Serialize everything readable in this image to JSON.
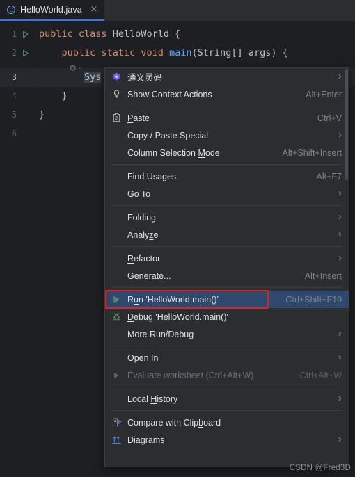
{
  "window": {
    "background": "#1E1F22"
  },
  "tab": {
    "label": "HelloWorld.java",
    "icon": "java-class-icon",
    "close_icon": "close-icon",
    "close_glyph": "×"
  },
  "editor": {
    "lines": [
      {
        "number": "1",
        "has_run_gutter": true,
        "text": "public class HelloWorld {"
      },
      {
        "number": "2",
        "has_run_gutter": true,
        "text": "    public static void main(String[] args) {"
      },
      {
        "number": "3",
        "has_run_gutter": false,
        "text": "        Sys",
        "current": true
      },
      {
        "number": "4",
        "has_run_gutter": false,
        "text": "    }"
      },
      {
        "number": "5",
        "has_run_gutter": false,
        "text": "}"
      },
      {
        "number": "6",
        "has_run_gutter": false,
        "text": ""
      }
    ],
    "inlay_hint_icon": "tongyi-lingma-icon",
    "inlay_chevron": "ˇ",
    "colors": {
      "keyword": "#CF8E6D",
      "function": "#56A8F5",
      "identifier": "#BCBEC4",
      "line_number": "#606366",
      "current_line_bg": "#26282E",
      "selection_bg": "#38424C"
    }
  },
  "context_menu": {
    "background": "#2B2D30",
    "selected_background": "#2F486E",
    "items": [
      {
        "id": "tongyi-lingma",
        "label": "通义灵码",
        "icon": "tongyi-lingma-icon",
        "arrow": "›",
        "shortcut": ""
      },
      {
        "id": "show-context-actions",
        "label": "Show Context Actions",
        "icon": "lightbulb-icon",
        "arrow": "",
        "shortcut": "Alt+Enter"
      },
      {
        "id": "separator-1",
        "separator": true
      },
      {
        "id": "paste",
        "label": "Paste",
        "mnemonic": "P",
        "icon": "clipboard-icon",
        "arrow": "",
        "shortcut": "Ctrl+V"
      },
      {
        "id": "copy-paste-special",
        "label": "Copy / Paste Special",
        "icon": "",
        "arrow": "›",
        "shortcut": ""
      },
      {
        "id": "column-selection-mode",
        "label": "Column Selection Mode",
        "mnemonic": "M",
        "icon": "",
        "arrow": "",
        "shortcut": "Alt+Shift+Insert"
      },
      {
        "id": "separator-2",
        "separator": true
      },
      {
        "id": "find-usages",
        "label": "Find Usages",
        "mnemonic": "U",
        "icon": "",
        "arrow": "",
        "shortcut": "Alt+F7"
      },
      {
        "id": "go-to",
        "label": "Go To",
        "icon": "",
        "arrow": "›",
        "shortcut": ""
      },
      {
        "id": "separator-3",
        "separator": true
      },
      {
        "id": "folding",
        "label": "Folding",
        "icon": "",
        "arrow": "›",
        "shortcut": ""
      },
      {
        "id": "analyze",
        "label": "Analyze",
        "mnemonic": "z",
        "icon": "",
        "arrow": "›",
        "shortcut": ""
      },
      {
        "id": "separator-4",
        "separator": true
      },
      {
        "id": "refactor",
        "label": "Refactor",
        "mnemonic": "R",
        "icon": "",
        "arrow": "›",
        "shortcut": ""
      },
      {
        "id": "generate",
        "label": "Generate...",
        "icon": "",
        "arrow": "",
        "shortcut": "Alt+Insert"
      },
      {
        "id": "separator-5",
        "separator": true
      },
      {
        "id": "run-helloworld-main",
        "label": "Run 'HelloWorld.main()'",
        "mnemonic": "u",
        "icon": "run-icon",
        "arrow": "",
        "shortcut": "Ctrl+Shift+F10",
        "selected": true
      },
      {
        "id": "debug-helloworld-main",
        "label": "Debug 'HelloWorld.main()'",
        "mnemonic": "D",
        "icon": "debug-bug-icon",
        "arrow": "",
        "shortcut": ""
      },
      {
        "id": "more-run-debug",
        "label": "More Run/Debug",
        "icon": "",
        "arrow": "›",
        "shortcut": ""
      },
      {
        "id": "separator-6",
        "separator": true
      },
      {
        "id": "open-in",
        "label": "Open In",
        "icon": "",
        "arrow": "›",
        "shortcut": ""
      },
      {
        "id": "evaluate-worksheet",
        "label": "Evaluate worksheet (Ctrl+Alt+W)",
        "icon": "run-disabled-icon",
        "arrow": "",
        "shortcut": "Ctrl+Alt+W",
        "disabled": true
      },
      {
        "id": "separator-7",
        "separator": true
      },
      {
        "id": "local-history",
        "label": "Local History",
        "mnemonic": "H",
        "icon": "",
        "arrow": "›",
        "shortcut": ""
      },
      {
        "id": "separator-8",
        "separator": true
      },
      {
        "id": "compare-with-clipboard",
        "label": "Compare with Clipboard",
        "mnemonic": "b",
        "icon": "compare-icon",
        "arrow": "",
        "shortcut": ""
      },
      {
        "id": "diagrams",
        "label": "Diagrams",
        "icon": "diagrams-icon",
        "arrow": "›",
        "shortcut": ""
      }
    ]
  },
  "annotation": {
    "color": "#E01E1E",
    "target": "run-helloworld-main"
  },
  "watermark": {
    "text": "CSDN @Fred3D"
  }
}
